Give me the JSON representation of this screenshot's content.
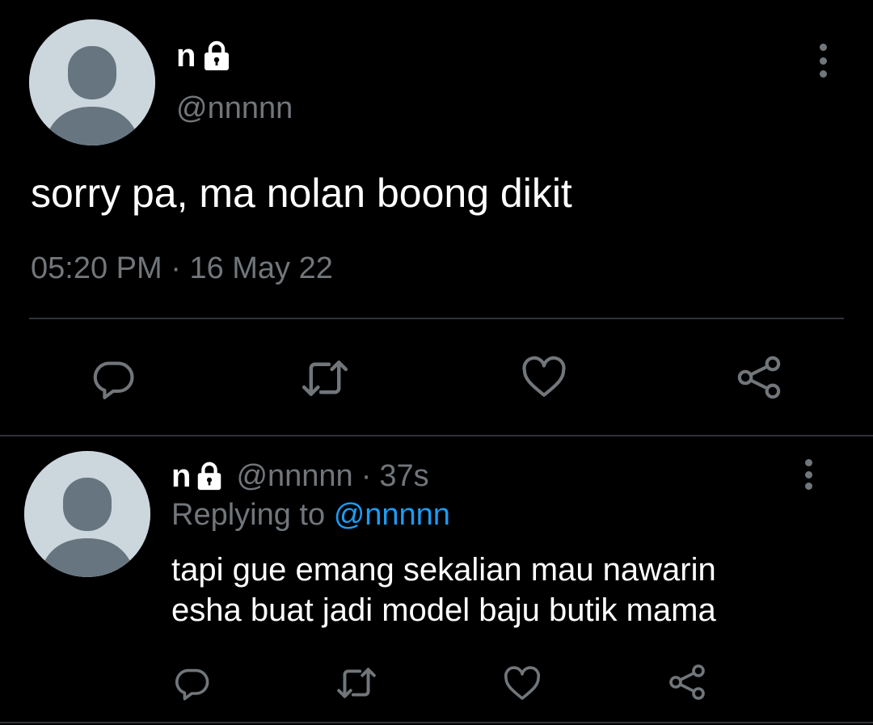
{
  "main_tweet": {
    "display_name": "n",
    "handle": "@nnnnn",
    "text": "sorry pa, ma nolan boong dikit",
    "time": "05:20 PM",
    "separator": "·",
    "date": "16 May 22",
    "actions": [
      "reply-icon",
      "retweet-icon",
      "like-icon",
      "share-icon"
    ]
  },
  "reply": {
    "display_name": "n",
    "handle": "@nnnnn",
    "separator": "·",
    "time_ago": "37s",
    "replying_label": "Replying to",
    "replying_handle": "@nnnnn",
    "text_lines": [
      "tapi gue emang sekalian mau nawarin",
      "esha buat jadi model baju butik mama"
    ],
    "actions": [
      "reply-icon",
      "retweet-icon",
      "like-icon",
      "share-icon"
    ]
  },
  "colors": {
    "background": "#000000",
    "primary_text": "#ffffff",
    "secondary_text": "#71767b",
    "link": "#1d9bf0",
    "avatar_bg": "#ccd6dd",
    "avatar_figure": "#66757f",
    "divider": "#2f3336"
  }
}
